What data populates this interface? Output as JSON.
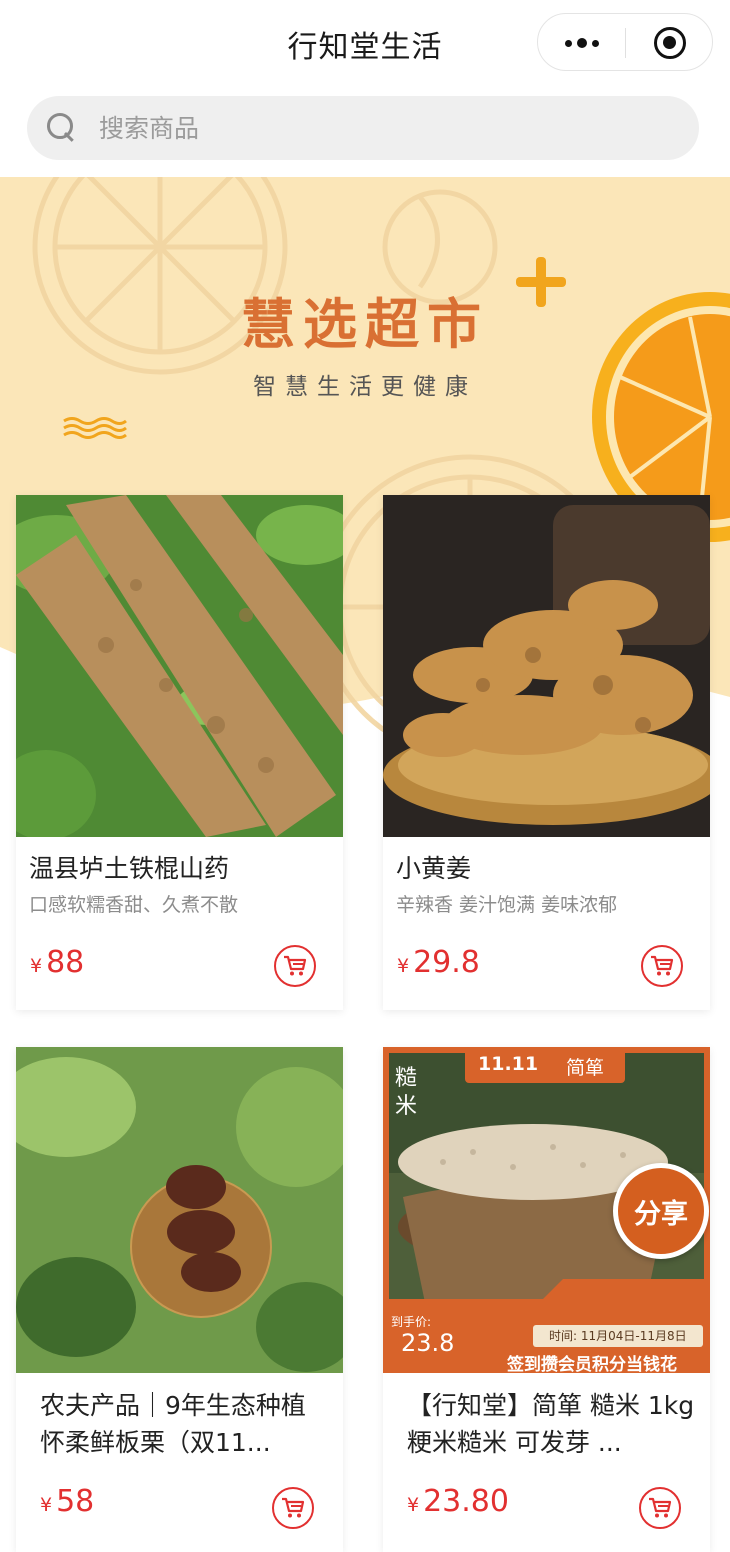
{
  "header": {
    "title": "行知堂生活",
    "more_icon": "more-dots-icon",
    "close_icon": "target-close-icon"
  },
  "search": {
    "placeholder": "搜索商品",
    "icon": "search-icon"
  },
  "banner": {
    "title": "慧选超市",
    "subtitle": "智慧生活更健康",
    "accent_color": "#d97033",
    "background_color": "#fbe6b8"
  },
  "products": [
    {
      "name": "温县垆土铁棍山药",
      "desc": "口感软糯香甜、久煮不散",
      "currency": "¥",
      "price": "88",
      "cart_icon": "cart-icon"
    },
    {
      "name": "小黄姜",
      "desc": "辛辣香 姜汁饱满 姜味浓郁",
      "currency": "¥",
      "price": "29.8",
      "cart_icon": "cart-icon"
    },
    {
      "name": "农夫产品｜9年生态种植怀柔鲜板栗（双11...",
      "currency": "¥",
      "price": "58",
      "cart_icon": "cart-icon"
    },
    {
      "name": "【行知堂】简箪 糙米 1kg 粳米糙米 可发芽 ...",
      "currency": "¥",
      "price": "23.80",
      "cart_icon": "cart-icon",
      "share_label": "分享",
      "image_overlay": {
        "tag": "11.11",
        "brand": "简箪",
        "side_label": "糙米",
        "price_label": "到手价:",
        "price_value": "23.8",
        "time_label": "时间: 11月04日-11月8日",
        "slogan": "签到攒会员积分当钱花"
      }
    }
  ],
  "colors": {
    "price_red": "#e23030",
    "banner_orange": "#d97033",
    "plus_yellow": "#f1a51d"
  }
}
